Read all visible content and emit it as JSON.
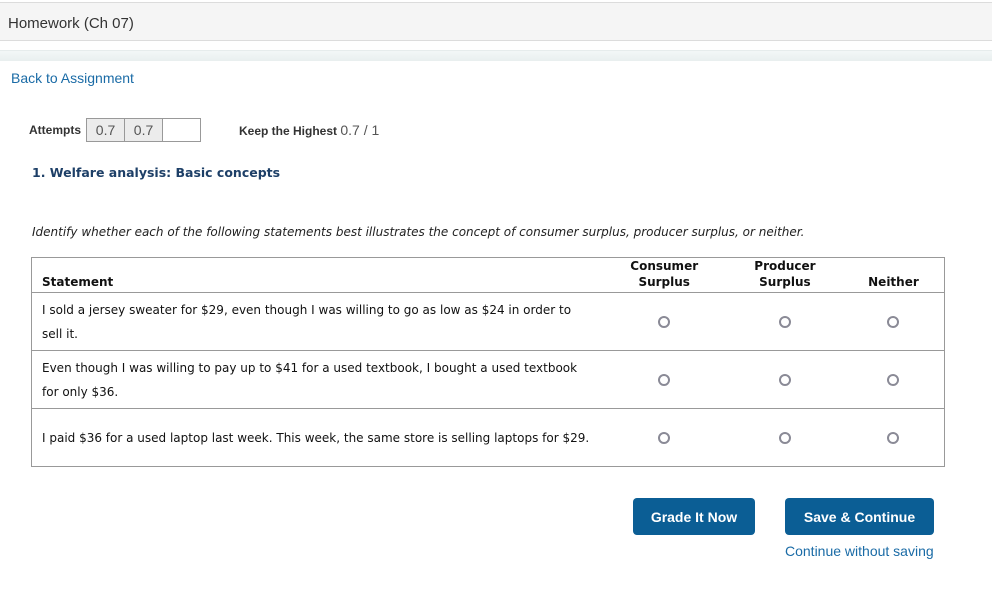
{
  "header": {
    "title": "Homework (Ch 07)"
  },
  "nav": {
    "back_link": "Back to Assignment"
  },
  "attempts": {
    "label": "Attempts",
    "values": [
      "0.7",
      "0.7",
      ""
    ],
    "policy_label": "Keep the Highest",
    "score": "0.7 / 1"
  },
  "question": {
    "title": "1. Welfare analysis: Basic concepts",
    "instructions": "Identify whether each of the following statements best illustrates the concept of consumer surplus, producer surplus, or neither.",
    "table": {
      "headers": {
        "statement": "Statement",
        "consumer_line1": "Consumer",
        "consumer_line2": "Surplus",
        "producer_line1": "Producer",
        "producer_line2": "Surplus",
        "neither": "Neither"
      },
      "rows": [
        {
          "statement": "I sold a jersey sweater for $29, even though I was willing to go as low as $24 in order to sell it.",
          "selected": null
        },
        {
          "statement": "Even though I was willing to pay up to $41 for a used textbook, I bought a used textbook for only $36.",
          "selected": null
        },
        {
          "statement": "I paid $36 for a used laptop last week. This week, the same store is selling laptops for $29.",
          "selected": null
        }
      ]
    }
  },
  "actions": {
    "grade_label": "Grade It Now",
    "save_label": "Save & Continue",
    "continue_link": "Continue without saving"
  },
  "colors": {
    "button": "#0b5e95",
    "link": "#1a6ba6",
    "question_title": "#1d3f67"
  }
}
